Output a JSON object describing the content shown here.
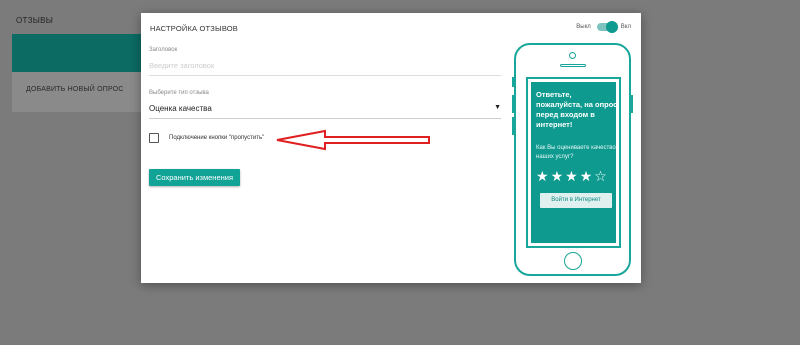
{
  "background": {
    "title": "ОТЗЫВЫ",
    "add_survey": "ДОБАВИТЬ НОВЫЙ ОПРОС"
  },
  "modal": {
    "title": "НАСТРОЙКА ОТЗЫВОВ",
    "toggle_off": "Выкл",
    "toggle_on": "Вкл",
    "toggle_state": "on",
    "heading_label": "Заголовок",
    "heading_placeholder": "Введите заголовок",
    "type_label": "Выберите тип отзыва",
    "type_value": "Оценка качества",
    "skip_checkbox_label": "Подключение кнопки \"пропустить\"",
    "skip_checked": false,
    "save_button": "Сохранить изменения"
  },
  "preview": {
    "heading": "Ответьте, пожалуйста, на опрос перед входом в интернет!",
    "question": "Как Вы оцениваете качество наших услуг?",
    "stars_total": 5,
    "stars_filled": 4,
    "login_button": "Войти в Интернет"
  },
  "colors": {
    "accent": "#12a397",
    "annotation_arrow": "#e02020"
  }
}
